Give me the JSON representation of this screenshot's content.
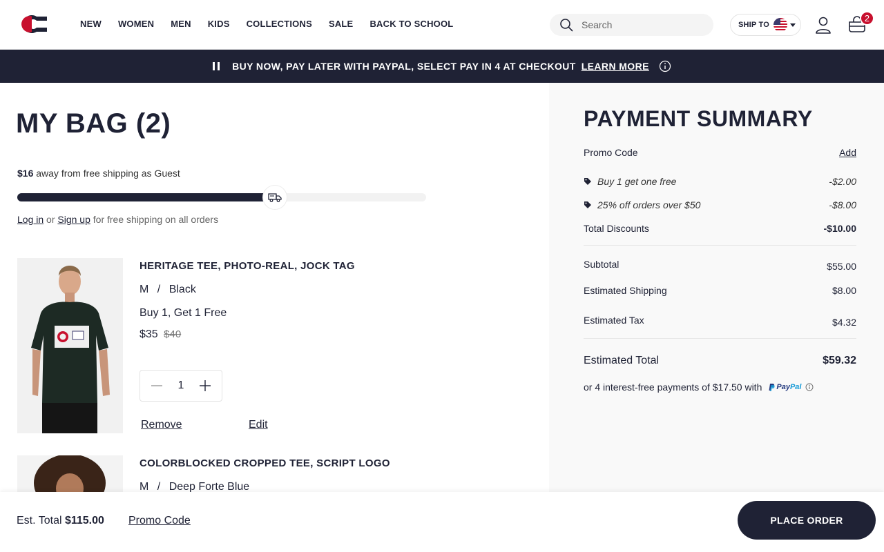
{
  "header": {
    "nav": [
      "NEW",
      "WOMEN",
      "MEN",
      "KIDS",
      "COLLECTIONS",
      "SALE",
      "BACK TO SCHOOL"
    ],
    "search_placeholder": "Search",
    "ship_to_label": "SHIP TO",
    "bag_count": "2",
    "brand_colors": {
      "navy": "#1f2235",
      "red": "#c8102e"
    }
  },
  "banner": {
    "text": "BUY NOW, PAY LATER WITH PAYPAL, SELECT PAY IN 4 AT CHECKOUT",
    "link": "LEARN MORE"
  },
  "bag": {
    "title": "MY BAG (2)",
    "shipping_amount": "$16",
    "shipping_text": " away from free shipping as Guest",
    "shipping_progress": 0.63,
    "login_label": "Log in",
    "or_text": "or",
    "signup_label": "Sign up",
    "signup_suffix": "for free shipping on all orders",
    "items": [
      {
        "name": "HERITAGE TEE, PHOTO-REAL, JOCK TAG",
        "size": "M",
        "color": "Black",
        "offer": "Buy 1, Get 1 Free",
        "price": "$35",
        "original_price": "$40",
        "quantity": "1",
        "remove_label": "Remove",
        "edit_label": "Edit"
      },
      {
        "name": "COLORBLOCKED CROPPED TEE, SCRIPT LOGO",
        "size": "M",
        "color": "Deep Forte Blue"
      }
    ]
  },
  "summary": {
    "title": "PAYMENT SUMMARY",
    "promo_code_label": "Promo Code",
    "promo_add_label": "Add",
    "discounts": [
      {
        "label": "Buy 1 get one free",
        "value": "-$2.00"
      },
      {
        "label": "25% off orders over $50",
        "value": "-$8.00"
      }
    ],
    "total_discounts_label": "Total Discounts",
    "total_discounts_value": "-$10.00",
    "subtotal_label": "Subtotal",
    "subtotal_value": "$55.00",
    "shipping_label": "Estimated Shipping",
    "shipping_value": "$8.00",
    "tax_label": "Estimated Tax",
    "tax_value": "$4.32",
    "total_label": "Estimated Total",
    "total_value": "$59.32",
    "paypal_text": "or 4 interest-free payments of $17.50 with",
    "paypal_logo_a": "Pay",
    "paypal_logo_b": "Pal"
  },
  "sticky": {
    "est_label": "Est. Total",
    "est_value": "$115.00",
    "promo_label": "Promo Code",
    "place_order_label": "PLACE ORDER"
  }
}
